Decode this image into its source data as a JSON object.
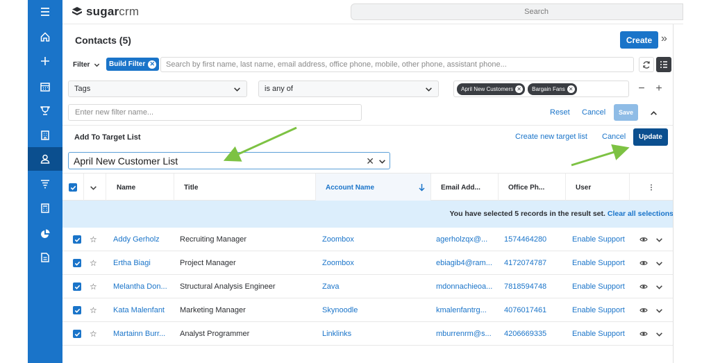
{
  "app": {
    "logo_bold": "sugar",
    "logo_light": "crm"
  },
  "search": {
    "placeholder": "Search"
  },
  "header": {
    "title": "Contacts (5)",
    "create_label": "Create"
  },
  "filter": {
    "label": "Filter",
    "build_filter": "Build Filter",
    "search_placeholder": "Search by first name, last name, email address, office phone, mobile, other phone, assistant phone..."
  },
  "tag_filter": {
    "field": "Tags",
    "operator": "is any of",
    "values": [
      "April New Customers",
      "Bargain Fans"
    ]
  },
  "filter_name": {
    "placeholder": "Enter new filter name...",
    "reset": "Reset",
    "cancel": "Cancel",
    "save": "Save"
  },
  "target": {
    "label": "Add To Target List",
    "create_new": "Create new target list",
    "cancel": "Cancel",
    "update": "Update",
    "selected": "April New Customer List"
  },
  "table": {
    "columns": [
      "Name",
      "Title",
      "Account Name",
      "Email Add...",
      "Office Ph...",
      "User"
    ],
    "banner": "You have selected 5 records in the result set.",
    "clear_link": "Clear all selections",
    "rows": [
      {
        "name": "Addy Gerholz",
        "title": "Recruiting Manager",
        "account": "Zoombox",
        "email": "agerholzqx@...",
        "phone": "1574464280",
        "user": "Enable Support"
      },
      {
        "name": "Ertha Biagi",
        "title": "Project Manager",
        "account": "Zoombox",
        "email": "ebiagib4@ram...",
        "phone": "4172074787",
        "user": "Enable Support"
      },
      {
        "name": "Melantha Don...",
        "title": "Structural Analysis Engineer",
        "account": "Zava",
        "email": "mdonnachieoa...",
        "phone": "7818594748",
        "user": "Enable Support"
      },
      {
        "name": "Kata Malenfant",
        "title": "Marketing Manager",
        "account": "Skynoodle",
        "email": "kmalenfantrg...",
        "phone": "4076017461",
        "user": "Enable Support"
      },
      {
        "name": "Martainn Burr...",
        "title": "Analyst Programmer",
        "account": "Linklinks",
        "email": "mburrenrm@s...",
        "phone": "4206669335",
        "user": "Enable Support"
      }
    ]
  },
  "colors": {
    "brand": "#1a74c9",
    "nav_active": "#0b4f8f",
    "banner": "#dceefc",
    "arrow": "#7dc243"
  },
  "nav_icons": [
    "menu-icon",
    "home-icon",
    "plus-icon",
    "calendar-icon",
    "trophy-icon",
    "building-icon",
    "contact-icon",
    "filter-icon",
    "calculator-icon",
    "chart-icon",
    "document-icon"
  ]
}
